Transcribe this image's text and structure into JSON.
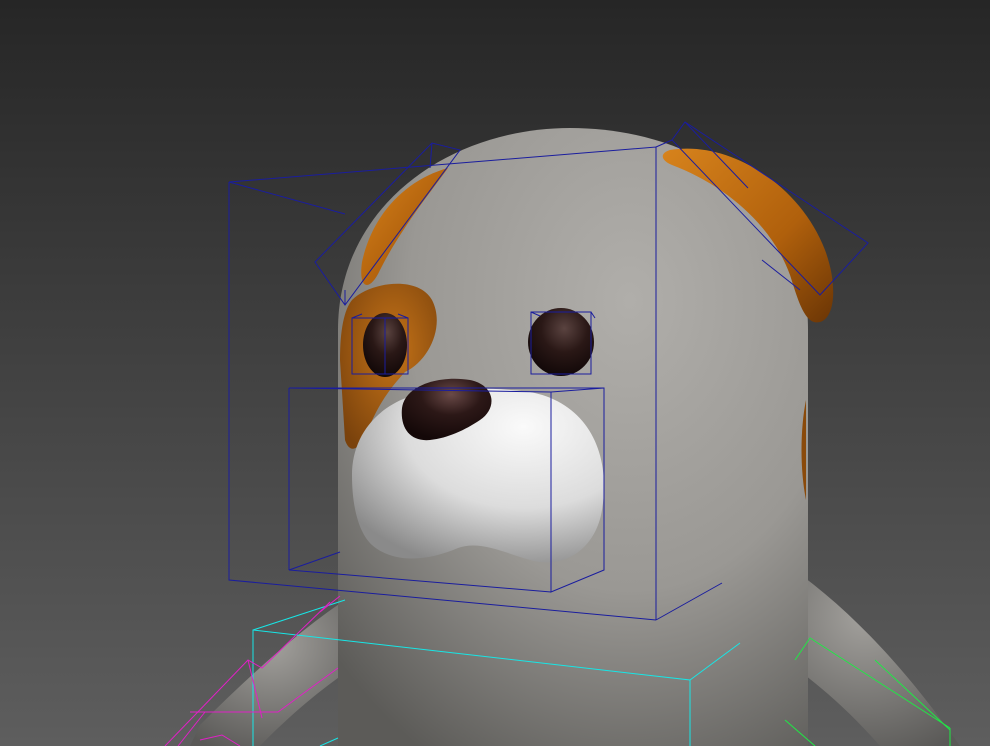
{
  "viewport": {
    "background_top": "#262626",
    "background_bottom": "#5e5e5e"
  },
  "character": {
    "body_color": "#9a9894",
    "patch_color": "#b8690f",
    "ear_color": "#c06a10",
    "muzzle_color": "#eeeeee",
    "eye_color": "#1d1110",
    "nose_color": "#231213"
  },
  "wireframe": {
    "head_bbox_color": "#1a1d9e",
    "chest_bbox_color": "#17e6e6",
    "arm_left_color": "#e020c6",
    "arm_right_color": "#1fe845"
  }
}
